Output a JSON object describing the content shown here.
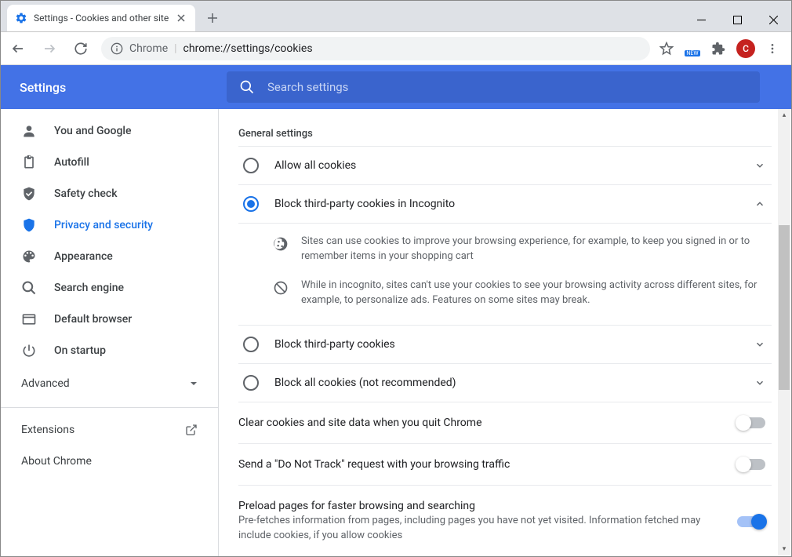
{
  "window": {
    "tab_title": "Settings - Cookies and other site",
    "url_prefix": "Chrome",
    "url": "chrome://settings/cookies",
    "avatar_letter": "C",
    "new_badge": "NEW"
  },
  "header": {
    "title": "Settings",
    "search_placeholder": "Search settings"
  },
  "sidebar": {
    "items": [
      {
        "label": "You and Google"
      },
      {
        "label": "Autofill"
      },
      {
        "label": "Safety check"
      },
      {
        "label": "Privacy and security"
      },
      {
        "label": "Appearance"
      },
      {
        "label": "Search engine"
      },
      {
        "label": "Default browser"
      },
      {
        "label": "On startup"
      }
    ],
    "advanced": "Advanced",
    "extensions": "Extensions",
    "about": "About Chrome"
  },
  "main": {
    "section_title": "General settings",
    "radios": [
      {
        "label": "Allow all cookies"
      },
      {
        "label": "Block third-party cookies in Incognito"
      },
      {
        "label": "Block third-party cookies"
      },
      {
        "label": "Block all cookies (not recommended)"
      }
    ],
    "desc1": "Sites can use cookies to improve your browsing experience, for example, to keep you signed in or to remember items in your shopping cart",
    "desc2": "While in incognito, sites can't use your cookies to see your browsing activity across different sites, for example, to personalize ads. Features on some sites may break.",
    "toggles": [
      {
        "label": "Clear cookies and site data when you quit Chrome"
      },
      {
        "label": "Send a \"Do Not Track\" request with your browsing traffic"
      },
      {
        "label": "Preload pages for faster browsing and searching",
        "sub": "Pre-fetches information from pages, including pages you have not yet visited. Information fetched may include cookies, if you allow cookies"
      }
    ]
  }
}
